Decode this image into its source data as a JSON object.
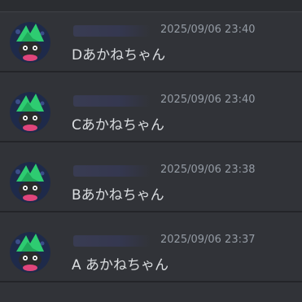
{
  "messages": [
    {
      "timestamp": "2025/09/06 23:40",
      "text": "Dあかねちゃん"
    },
    {
      "timestamp": "2025/09/06 23:40",
      "text": "Cあかねちゃん"
    },
    {
      "timestamp": "2025/09/06 23:38",
      "text": "Bあかねちゃん"
    },
    {
      "timestamp": "2025/09/06 23:37",
      "text": "A あかねちゃん"
    }
  ],
  "colors": {
    "background": "#313338",
    "separator": "#2b2d31",
    "timestamp": "#949ba4",
    "text": "#dbdee1",
    "avatar_hat": "#2ecc71",
    "avatar_bg": "#1e2a4a",
    "avatar_face": "#e0457b"
  },
  "icons": {
    "avatar": "green-hat-character-avatar-icon"
  }
}
